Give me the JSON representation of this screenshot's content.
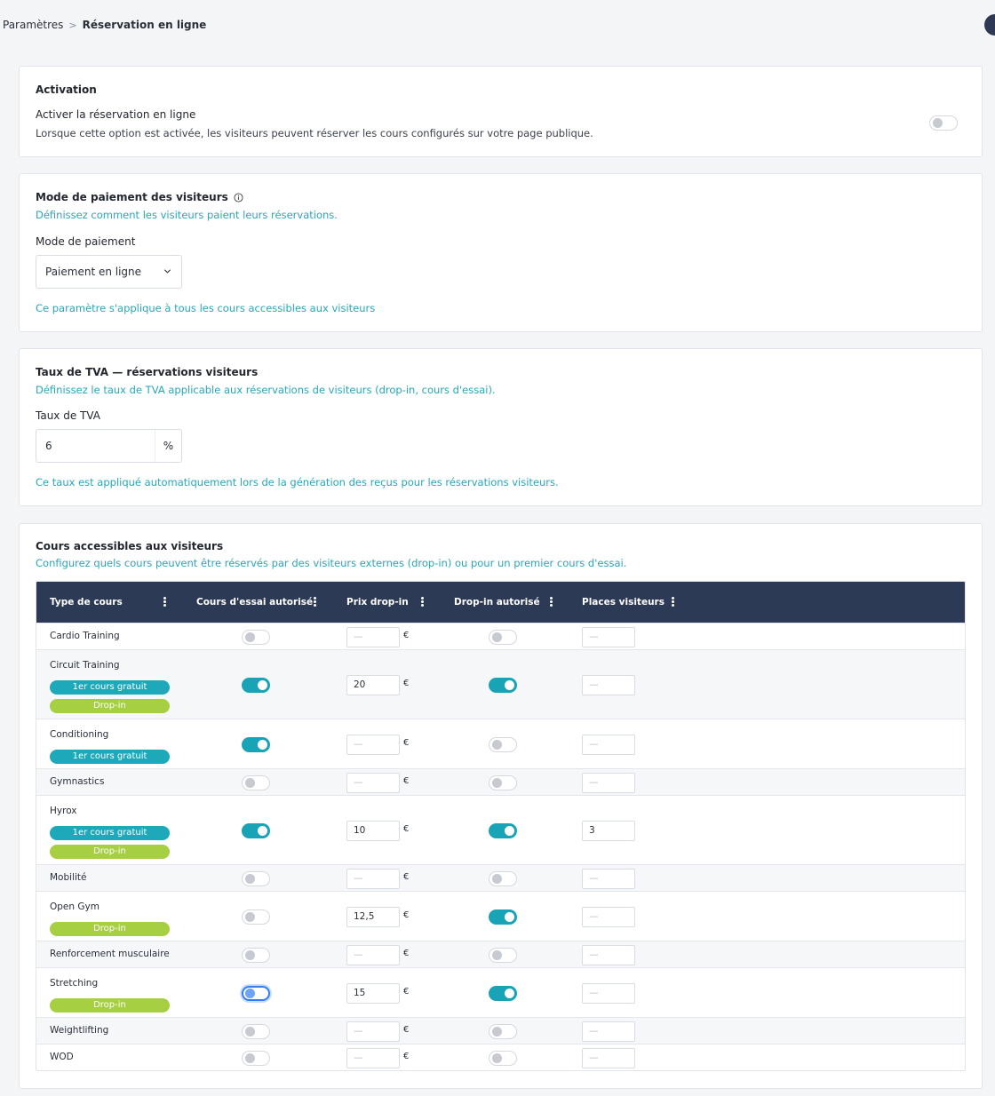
{
  "breadcrumb": {
    "parent": "Paramètres",
    "separator": ">",
    "current": "Réservation en ligne"
  },
  "activation": {
    "title": "Activation",
    "label": "Activer la réservation en ligne",
    "description": "Lorsque cette option est activée, les visiteurs peuvent réserver les cours configurés sur votre page publique.",
    "enabled": false
  },
  "payment": {
    "title": "Mode de paiement des visiteurs",
    "subtitle": "Définissez comment les visiteurs paient leurs réservations.",
    "field_label": "Mode de paiement",
    "selected": "Paiement en ligne",
    "note": "Ce paramètre s'applique à tous les cours accessibles aux visiteurs"
  },
  "vat": {
    "title": "Taux de TVA — réservations visiteurs",
    "subtitle": "Définissez le taux de TVA applicable aux réservations de visiteurs (drop-in, cours d'essai).",
    "field_label": "Taux de TVA",
    "value": "6",
    "unit": "%",
    "note": "Ce taux est appliqué automatiquement lors de la génération des reçus pour les réservations visiteurs."
  },
  "courses": {
    "title": "Cours accessibles aux visiteurs",
    "subtitle": "Configurez quels cours peuvent être réservés par des visiteurs externes (drop-in) ou pour un premier cours d'essai.",
    "columns": {
      "type": "Type de cours",
      "trial": "Cours d'essai autorisé",
      "price": "Prix drop-in",
      "dropin": "Drop-in autorisé",
      "places": "Places visiteurs"
    },
    "badge_trial": "1er cours gratuit",
    "badge_dropin": "Drop-in",
    "currency": "€",
    "empty_placeholder": "—",
    "rows": [
      {
        "name": "Cardio Training",
        "trial": false,
        "price": "",
        "dropin": false,
        "places": "",
        "badges": []
      },
      {
        "name": "Circuit Training",
        "trial": true,
        "price": "20",
        "dropin": true,
        "places": "",
        "badges": [
          "trial",
          "dropin"
        ]
      },
      {
        "name": "Conditioning",
        "trial": true,
        "price": "",
        "dropin": false,
        "places": "",
        "badges": [
          "trial"
        ]
      },
      {
        "name": "Gymnastics",
        "trial": false,
        "price": "",
        "dropin": false,
        "places": "",
        "badges": []
      },
      {
        "name": "Hyrox",
        "trial": true,
        "price": "10",
        "dropin": true,
        "places": "3",
        "badges": [
          "trial",
          "dropin"
        ]
      },
      {
        "name": "Mobilité",
        "trial": false,
        "price": "",
        "dropin": false,
        "places": "",
        "badges": []
      },
      {
        "name": "Open Gym",
        "trial": false,
        "price": "12,5",
        "dropin": true,
        "places": "",
        "badges": [
          "dropin"
        ]
      },
      {
        "name": "Renforcement musculaire",
        "trial": false,
        "price": "",
        "dropin": false,
        "places": "",
        "badges": []
      },
      {
        "name": "Stretching",
        "trial": false,
        "price": "15",
        "dropin": true,
        "places": "",
        "badges": [
          "dropin"
        ],
        "trial_focused": true
      },
      {
        "name": "Weightlifting",
        "trial": false,
        "price": "",
        "dropin": false,
        "places": "",
        "badges": []
      },
      {
        "name": "WOD",
        "trial": false,
        "price": "",
        "dropin": false,
        "places": "",
        "badges": []
      }
    ]
  }
}
